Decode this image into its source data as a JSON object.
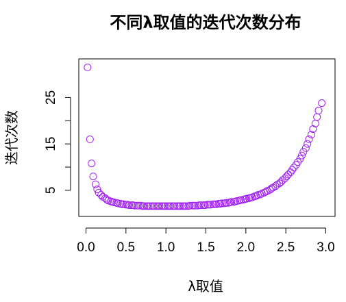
{
  "chart_data": {
    "type": "scatter",
    "title": "不同λ取值的迭代次数分布",
    "xlabel": "λ取值",
    "ylabel": "迭代次数",
    "xlim": [
      0.0,
      3.0
    ],
    "ylim": [
      1,
      32
    ],
    "xticks": [
      "0.0",
      "0.5",
      "1.0",
      "1.5",
      "2.0",
      "2.5",
      "3.0"
    ],
    "yticks": [
      "5",
      "15",
      "25"
    ],
    "grid": false,
    "marker_color": "#A020F0",
    "points": [
      [
        0.02,
        31.5
      ],
      [
        0.05,
        16.0
      ],
      [
        0.07,
        10.8
      ],
      [
        0.09,
        8.0
      ],
      [
        0.12,
        6.3
      ],
      [
        0.14,
        5.2
      ],
      [
        0.16,
        4.5
      ],
      [
        0.19,
        4.0
      ],
      [
        0.21,
        3.6
      ],
      [
        0.24,
        3.3
      ],
      [
        0.26,
        3.0
      ],
      [
        0.28,
        2.8
      ],
      [
        0.31,
        2.6
      ],
      [
        0.33,
        2.5
      ],
      [
        0.35,
        2.4
      ],
      [
        0.38,
        2.3
      ],
      [
        0.4,
        2.2
      ],
      [
        0.43,
        2.1
      ],
      [
        0.45,
        2.0
      ],
      [
        0.47,
        2.0
      ],
      [
        0.5,
        1.9
      ],
      [
        0.52,
        1.9
      ],
      [
        0.54,
        1.8
      ],
      [
        0.57,
        1.8
      ],
      [
        0.59,
        1.8
      ],
      [
        0.61,
        1.7
      ],
      [
        0.64,
        1.7
      ],
      [
        0.66,
        1.7
      ],
      [
        0.69,
        1.7
      ],
      [
        0.71,
        1.6
      ],
      [
        0.73,
        1.6
      ],
      [
        0.76,
        1.6
      ],
      [
        0.78,
        1.6
      ],
      [
        0.8,
        1.6
      ],
      [
        0.83,
        1.6
      ],
      [
        0.85,
        1.6
      ],
      [
        0.88,
        1.6
      ],
      [
        0.9,
        1.6
      ],
      [
        0.92,
        1.6
      ],
      [
        0.95,
        1.6
      ],
      [
        0.97,
        1.6
      ],
      [
        0.99,
        1.6
      ],
      [
        1.02,
        1.6
      ],
      [
        1.04,
        1.6
      ],
      [
        1.06,
        1.6
      ],
      [
        1.09,
        1.6
      ],
      [
        1.11,
        1.6
      ],
      [
        1.14,
        1.6
      ],
      [
        1.16,
        1.6
      ],
      [
        1.18,
        1.6
      ],
      [
        1.21,
        1.6
      ],
      [
        1.23,
        1.6
      ],
      [
        1.25,
        1.6
      ],
      [
        1.28,
        1.6
      ],
      [
        1.3,
        1.7
      ],
      [
        1.33,
        1.7
      ],
      [
        1.35,
        1.7
      ],
      [
        1.37,
        1.7
      ],
      [
        1.4,
        1.7
      ],
      [
        1.42,
        1.8
      ],
      [
        1.44,
        1.8
      ],
      [
        1.47,
        1.8
      ],
      [
        1.49,
        1.8
      ],
      [
        1.52,
        1.9
      ],
      [
        1.54,
        1.9
      ],
      [
        1.56,
        1.9
      ],
      [
        1.59,
        2.0
      ],
      [
        1.61,
        2.0
      ],
      [
        1.63,
        2.0
      ],
      [
        1.66,
        2.1
      ],
      [
        1.68,
        2.1
      ],
      [
        1.7,
        2.2
      ],
      [
        1.73,
        2.2
      ],
      [
        1.75,
        2.3
      ],
      [
        1.78,
        2.3
      ],
      [
        1.8,
        2.4
      ],
      [
        1.82,
        2.5
      ],
      [
        1.85,
        2.5
      ],
      [
        1.87,
        2.6
      ],
      [
        1.89,
        2.7
      ],
      [
        1.92,
        2.8
      ],
      [
        1.94,
        2.9
      ],
      [
        1.97,
        3.0
      ],
      [
        1.99,
        3.1
      ],
      [
        2.01,
        3.2
      ],
      [
        2.04,
        3.3
      ],
      [
        2.06,
        3.4
      ],
      [
        2.08,
        3.5
      ],
      [
        2.11,
        3.7
      ],
      [
        2.13,
        3.8
      ],
      [
        2.15,
        4.0
      ],
      [
        2.18,
        4.1
      ],
      [
        2.2,
        4.3
      ],
      [
        2.23,
        4.5
      ],
      [
        2.25,
        4.7
      ],
      [
        2.27,
        4.9
      ],
      [
        2.3,
        5.1
      ],
      [
        2.32,
        5.4
      ],
      [
        2.34,
        5.6
      ],
      [
        2.37,
        5.9
      ],
      [
        2.39,
        6.2
      ],
      [
        2.42,
        6.5
      ],
      [
        2.44,
        6.8
      ],
      [
        2.46,
        7.2
      ],
      [
        2.49,
        7.6
      ],
      [
        2.51,
        8.0
      ],
      [
        2.53,
        8.4
      ],
      [
        2.56,
        8.9
      ],
      [
        2.58,
        9.4
      ],
      [
        2.6,
        9.9
      ],
      [
        2.63,
        10.5
      ],
      [
        2.65,
        11.1
      ],
      [
        2.68,
        11.8
      ],
      [
        2.7,
        12.5
      ],
      [
        2.72,
        13.3
      ],
      [
        2.75,
        14.1
      ],
      [
        2.77,
        15.0
      ],
      [
        2.79,
        16.0
      ],
      [
        2.82,
        17.0
      ],
      [
        2.84,
        18.2
      ],
      [
        2.87,
        19.4
      ],
      [
        2.89,
        20.8
      ],
      [
        2.91,
        22.2
      ],
      [
        2.95,
        23.8
      ]
    ]
  }
}
